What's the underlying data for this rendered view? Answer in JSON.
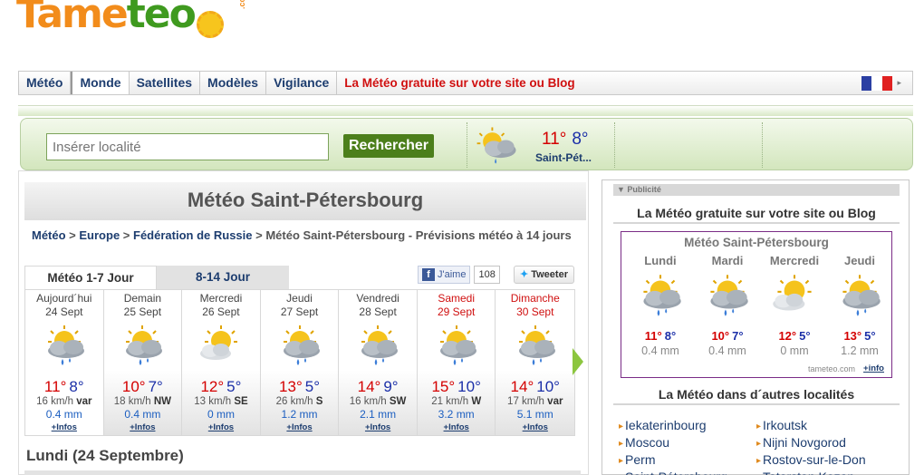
{
  "logo": {
    "part1": "Tame",
    "part2": "teo",
    "suffix": ".com"
  },
  "nav": {
    "items": [
      "Météo",
      "Monde",
      "Satellites",
      "Modèles",
      "Vigilance"
    ],
    "promo": "La Météo gratuite sur votre site ou Blog"
  },
  "search": {
    "placeholder": "Insérer localité",
    "button": "Rechercher",
    "current": {
      "hi": "11°",
      "lo": "8°",
      "city": "Saint-Pét..."
    }
  },
  "main": {
    "title": "Météo Saint-Pétersbourg",
    "breadcrumb": {
      "links": [
        "Météo",
        "Europe",
        "Fédération de Russie"
      ],
      "sep": " > ",
      "current": "Météo Saint-Pétersbourg - Prévisions météo à 14 jours"
    },
    "tabs": [
      "Météo 1-7 Jour",
      "8-14 Jour"
    ],
    "facebook": {
      "like": "J'aime",
      "count": "108"
    },
    "twitter": "Tweeter",
    "days": [
      {
        "name": "Aujourd´hui",
        "date": "24 Sept",
        "hi": "11°",
        "lo": "8°",
        "wind": "16 km/h",
        "dir": "var",
        "rain": "0.4 mm",
        "info": "+Infos",
        "icon": "sun-cloud-rain-icon",
        "weekend": false
      },
      {
        "name": "Demain",
        "date": "25 Sept",
        "hi": "10°",
        "lo": "7°",
        "wind": "18 km/h",
        "dir": "NW",
        "rain": "0.4 mm",
        "info": "+Infos",
        "icon": "sun-cloud-rain-icon",
        "weekend": false
      },
      {
        "name": "Mercredi",
        "date": "26 Sept",
        "hi": "12°",
        "lo": "5°",
        "wind": "13 km/h",
        "dir": "SE",
        "rain": "0 mm",
        "info": "+Infos",
        "icon": "sun-cloud-icon",
        "weekend": false
      },
      {
        "name": "Jeudi",
        "date": "27 Sept",
        "hi": "13°",
        "lo": "5°",
        "wind": "26 km/h",
        "dir": "S",
        "rain": "1.2 mm",
        "info": "+Infos",
        "icon": "sun-cloud-rain-icon",
        "weekend": false
      },
      {
        "name": "Vendredi",
        "date": "28 Sept",
        "hi": "14°",
        "lo": "9°",
        "wind": "16 km/h",
        "dir": "SW",
        "rain": "2.1 mm",
        "info": "+Infos",
        "icon": "sun-cloud-rain-icon",
        "weekend": false
      },
      {
        "name": "Samedi",
        "date": "29 Sept",
        "hi": "15°",
        "lo": "10°",
        "wind": "21 km/h",
        "dir": "W",
        "rain": "3.2 mm",
        "info": "+Infos",
        "icon": "sun-cloud-rain-icon",
        "weekend": true
      },
      {
        "name": "Dimanche",
        "date": "30 Sept",
        "hi": "14°",
        "lo": "10°",
        "wind": "17 km/h",
        "dir": "var",
        "rain": "5.1 mm",
        "info": "+Infos",
        "icon": "sun-cloud-rain-icon",
        "weekend": true
      }
    ],
    "section_title": "Lundi (24 Septembre)"
  },
  "sidebar": {
    "pub": "Publicité",
    "heading1": "La Météo gratuite sur votre site ou Blog",
    "widget": {
      "title": "Météo Saint-Pétersbourg",
      "days": [
        {
          "name": "Lundi",
          "hi": "11°",
          "lo": "8°",
          "rain": "0.4 mm",
          "icon": "sun-cloud-rain-icon"
        },
        {
          "name": "Mardi",
          "hi": "10°",
          "lo": "7°",
          "rain": "0.4 mm",
          "icon": "sun-cloud-rain-icon"
        },
        {
          "name": "Mercredi",
          "hi": "12°",
          "lo": "5°",
          "rain": "0 mm",
          "icon": "sun-cloud-icon"
        },
        {
          "name": "Jeudi",
          "hi": "13°",
          "lo": "5°",
          "rain": "1.2 mm",
          "icon": "sun-cloud-rain-icon"
        }
      ],
      "credit": "tameteo.com",
      "info": "+info"
    },
    "heading2": "La Météo dans d´autres localités",
    "cities": [
      "Iekaterinbourg",
      "Irkoutsk",
      "Moscou",
      "Nijni Novgorod",
      "Perm",
      "Rostov-sur-le-Don",
      "Saint-Pétersbourg",
      "Tatarstan Kazan"
    ]
  },
  "colors": {
    "accent_green": "#4c7f1b",
    "nav_blue": "#1d3d6f",
    "temp_hi": "#d40000",
    "temp_lo": "#1b2fa8",
    "promo_red": "#d01010"
  }
}
